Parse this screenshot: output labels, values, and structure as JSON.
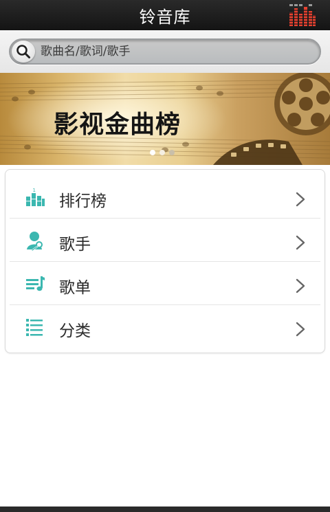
{
  "header": {
    "title": "铃音库",
    "equalizer_icon": "equalizer-icon",
    "equalizer_color": "#e8412f"
  },
  "search": {
    "placeholder": "歌曲名/歌词/歌手",
    "icon": "search-icon"
  },
  "banner": {
    "title": "影视金曲榜",
    "active_dot": 1,
    "dot_count": 3
  },
  "menu": {
    "accent_color": "#3bb7b0",
    "items": [
      {
        "label": "排行榜",
        "icon": "chart-bars-icon"
      },
      {
        "label": "歌手",
        "icon": "singer-icon"
      },
      {
        "label": "歌单",
        "icon": "playlist-icon"
      },
      {
        "label": "分类",
        "icon": "category-list-icon"
      }
    ]
  }
}
